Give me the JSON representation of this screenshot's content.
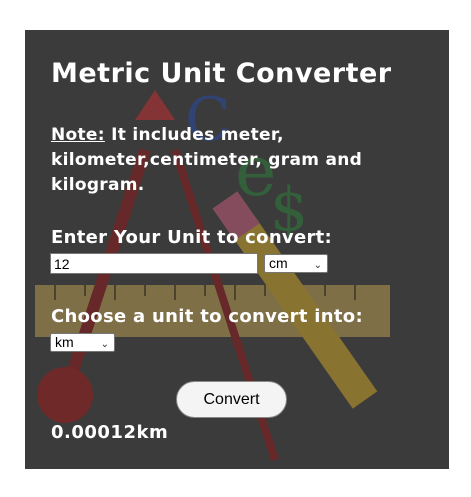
{
  "app": {
    "title": "Metric Unit Converter"
  },
  "note": {
    "label": "Note:",
    "text": " It includes meter, kilometer,centimeter, gram and kilogram."
  },
  "input_section": {
    "label": "Enter Your Unit to convert:",
    "value": "12",
    "from_unit": "cm"
  },
  "output_section": {
    "label": "Choose a unit to convert into:",
    "to_unit": "km"
  },
  "convert_button": {
    "label": "Convert"
  },
  "result": {
    "text": "0.00012km"
  },
  "colors": {
    "panel_bg": "#3b3b3b",
    "text": "#ffffff",
    "button_bg": "#f4f4f4"
  },
  "icons": [
    "chevron-down-icon"
  ]
}
